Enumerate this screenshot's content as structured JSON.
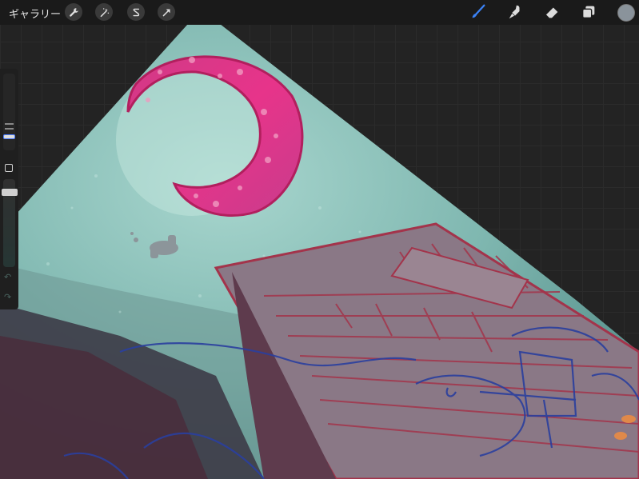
{
  "topbar": {
    "gallery_label": "ギャラリー",
    "left_tools": [
      {
        "name": "actions",
        "icon": "wrench-icon"
      },
      {
        "name": "adjustments",
        "icon": "magic-wand-icon"
      },
      {
        "name": "selection",
        "icon": "selection-s-icon"
      },
      {
        "name": "transform",
        "icon": "arrow-cursor-icon"
      }
    ],
    "right_tools": [
      {
        "name": "brush",
        "icon": "brush-icon",
        "active": true
      },
      {
        "name": "smudge",
        "icon": "smudge-finger-icon",
        "active": false
      },
      {
        "name": "eraser",
        "icon": "eraser-icon",
        "active": false
      },
      {
        "name": "layers",
        "icon": "layers-icon",
        "active": false
      }
    ],
    "current_color": "#8a939b",
    "active_color": "#3b82f6"
  },
  "sidebar": {
    "brush_size_icon": "size-slider",
    "modify_icon": "square-icon",
    "brush_opacity_icon": "opacity-slider",
    "undo_icon": "undo-icon",
    "redo_icon": "redo-icon",
    "undo_glyph": "↶",
    "redo_glyph": "↷"
  },
  "canvas": {
    "background": "#232323",
    "sky_color": "#7fb7b0",
    "moon_color": "#e0307a",
    "roof_color": "#8a7886",
    "sketch_color": "#2a3f9e"
  }
}
